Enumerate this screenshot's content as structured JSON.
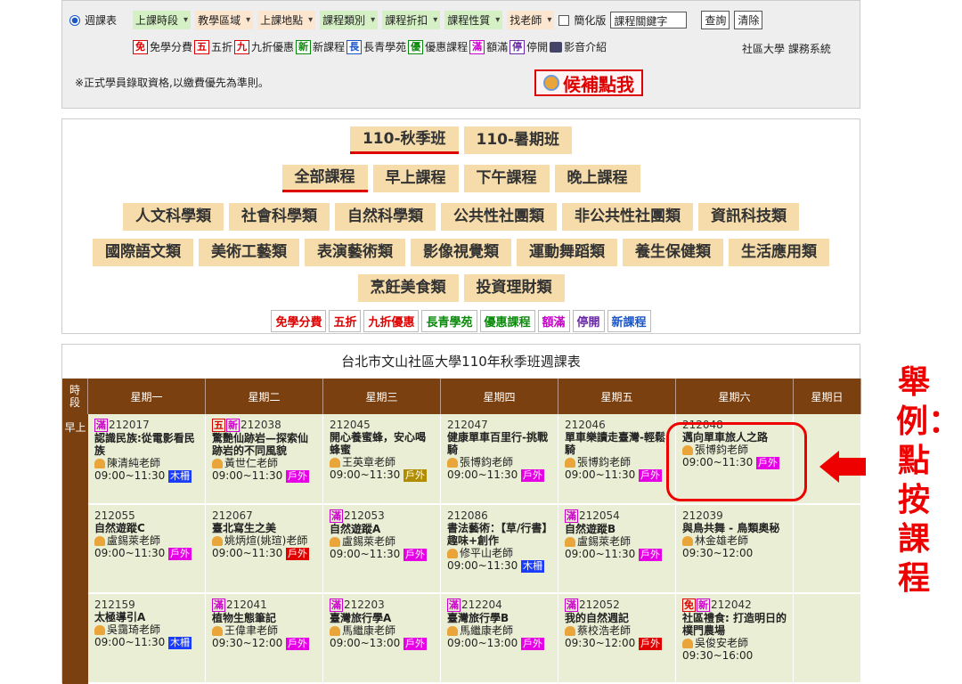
{
  "filter": {
    "weekly_label": "週課表",
    "selects": [
      "上課時段",
      "教學區域",
      "上課地點",
      "課程類別",
      "課程折扣",
      "課程性質",
      "找老師"
    ],
    "simple_label": "簡化版",
    "keyword": "課程關鍵字",
    "query_btn": "查詢",
    "clear_btn": "清除",
    "legend": [
      {
        "tag": "免",
        "text": "免學分費"
      },
      {
        "tag": "五",
        "text": "五折"
      },
      {
        "tag": "九",
        "text": "九折優惠"
      },
      {
        "tag": "新",
        "text": "新課程"
      },
      {
        "tag": "長",
        "text": "長青學苑"
      },
      {
        "tag": "優",
        "text": "優惠課程"
      },
      {
        "tag": "滿",
        "text": "額滿"
      },
      {
        "tag": "停",
        "text": "停開"
      },
      {
        "tag": "",
        "text": "影音介紹"
      }
    ],
    "system_name": "社區大學 課務系統",
    "note": "※正式學員錄取資格,以繳費優先為準則。",
    "waitlist_btn": "候補點我"
  },
  "menu": {
    "terms": [
      "110-秋季班",
      "110-暑期班"
    ],
    "times": [
      "全部課程",
      "早上課程",
      "下午課程",
      "晚上課程"
    ],
    "cats1": [
      "人文科學類",
      "社會科學類",
      "自然科學類",
      "公共性社團類",
      "非公共性社團類",
      "資訊科技類"
    ],
    "cats2": [
      "國際語文類",
      "美術工藝類",
      "表演藝術類",
      "影像視覺類",
      "運動舞蹈類",
      "養生保健類",
      "生活應用類"
    ],
    "cats3": [
      "烹飪美食類",
      "投資理財類"
    ],
    "tags": [
      "免學分費",
      "五折",
      "九折優惠",
      "長青學苑",
      "優惠課程",
      "額滿",
      "停開",
      "新課程"
    ]
  },
  "schedule": {
    "title": "台北市文山社區大學110年秋季班週課表",
    "slot_header": "時段",
    "days": [
      "星期一",
      "星期二",
      "星期三",
      "星期四",
      "星期五",
      "星期六",
      "星期日"
    ],
    "slot": "早上",
    "rows": [
      [
        {
          "tags": [
            "滿"
          ],
          "code": "212017",
          "name": "認識民族:從電影看民族",
          "teacher": "陳清純老師",
          "time": "09:00~11:30",
          "loc": "木柵"
        },
        {
          "tags": [
            "五",
            "新"
          ],
          "code": "212038",
          "name": "驚艷仙跡岩—探索仙跡岩的不同風貌",
          "teacher": "黃世仁老師",
          "time": "09:00~11:30",
          "loc": "戶外"
        },
        {
          "tags": [],
          "code": "212045",
          "name": "開心養蜜蜂，安心喝蜂蜜",
          "teacher": "王英章老師",
          "time": "09:00~11:30",
          "loc": "戶外"
        },
        {
          "tags": [],
          "code": "212047",
          "name": "健康單車百里行-挑戰騎",
          "teacher": "張博鈞老師",
          "time": "09:00~11:30",
          "loc": "戶外"
        },
        {
          "tags": [],
          "code": "212046",
          "name": "單車樂讀走臺灣-輕鬆騎",
          "teacher": "張博鈞老師",
          "time": "09:00~11:30",
          "loc": "戶外"
        },
        {
          "tags": [],
          "code": "212048",
          "name": "邁向單車旅人之路",
          "teacher": "張博鈞老師",
          "time": "09:00~11:30",
          "loc": "戶外"
        },
        null
      ],
      [
        {
          "tags": [],
          "code": "212055",
          "name": "自然遊蹤C",
          "teacher": "盧錫萊老師",
          "time": "09:00~11:30",
          "loc": "戶外"
        },
        {
          "tags": [],
          "code": "212067",
          "name": "臺北寫生之美",
          "teacher": "姚炳煊(姚瑄)老師",
          "time": "09:00~11:30",
          "loc": "戶外"
        },
        {
          "tags": [
            "滿"
          ],
          "code": "212053",
          "name": "自然遊蹤A",
          "teacher": "盧錫萊老師",
          "time": "09:00~11:30",
          "loc": "戶外"
        },
        {
          "tags": [],
          "code": "212086",
          "name": "書法藝術：【草/行書】趣味+創作",
          "teacher": "修平山老師",
          "time": "09:00~11:30",
          "loc": "木柵"
        },
        {
          "tags": [
            "滿"
          ],
          "code": "212054",
          "name": "自然遊蹤B",
          "teacher": "盧錫萊老師",
          "time": "09:00~11:30",
          "loc": "戶外"
        },
        {
          "tags": [],
          "code": "212039",
          "name": "與鳥共舞 - 鳥類奧秘",
          "teacher": "林金雄老師",
          "time": "09:30~12:00",
          "loc": ""
        },
        null
      ],
      [
        {
          "tags": [],
          "code": "212159",
          "name": "太極導引A",
          "teacher": "吳靄琦老師",
          "time": "09:00~11:30",
          "loc": "木柵"
        },
        {
          "tags": [
            "滿"
          ],
          "code": "212041",
          "name": "植物生態筆記",
          "teacher": "王偉聿老師",
          "time": "09:30~12:00",
          "loc": "戶外"
        },
        {
          "tags": [
            "滿"
          ],
          "code": "212203",
          "name": "臺灣旅行學A",
          "teacher": "馬繼康老師",
          "time": "09:00~13:00",
          "loc": "戶外"
        },
        {
          "tags": [
            "滿"
          ],
          "code": "212204",
          "name": "臺灣旅行學B",
          "teacher": "馬繼康老師",
          "time": "09:00~13:00",
          "loc": "戶外"
        },
        {
          "tags": [
            "滿"
          ],
          "code": "212052",
          "name": "我的自然週記",
          "teacher": "蔡校浩老師",
          "time": "09:30~12:00",
          "loc": "戶外"
        },
        {
          "tags": [
            "免",
            "新"
          ],
          "code": "212042",
          "name": "社區禮食: 打造明日的樸門農場",
          "teacher": "吳俊安老師",
          "time": "09:30~16:00",
          "loc": ""
        },
        null
      ]
    ]
  },
  "callout": "舉例：點按課程",
  "colors": {
    "loc_outdoor": "#e600e6",
    "loc_outdoor_red": "#e00000",
    "loc_mucha": "#1a3cff",
    "loc_olive": "#b08c00",
    "header_brown": "#7a4010",
    "cell_bg": "#eaeed4",
    "button_tan": "#f5dcaa"
  }
}
